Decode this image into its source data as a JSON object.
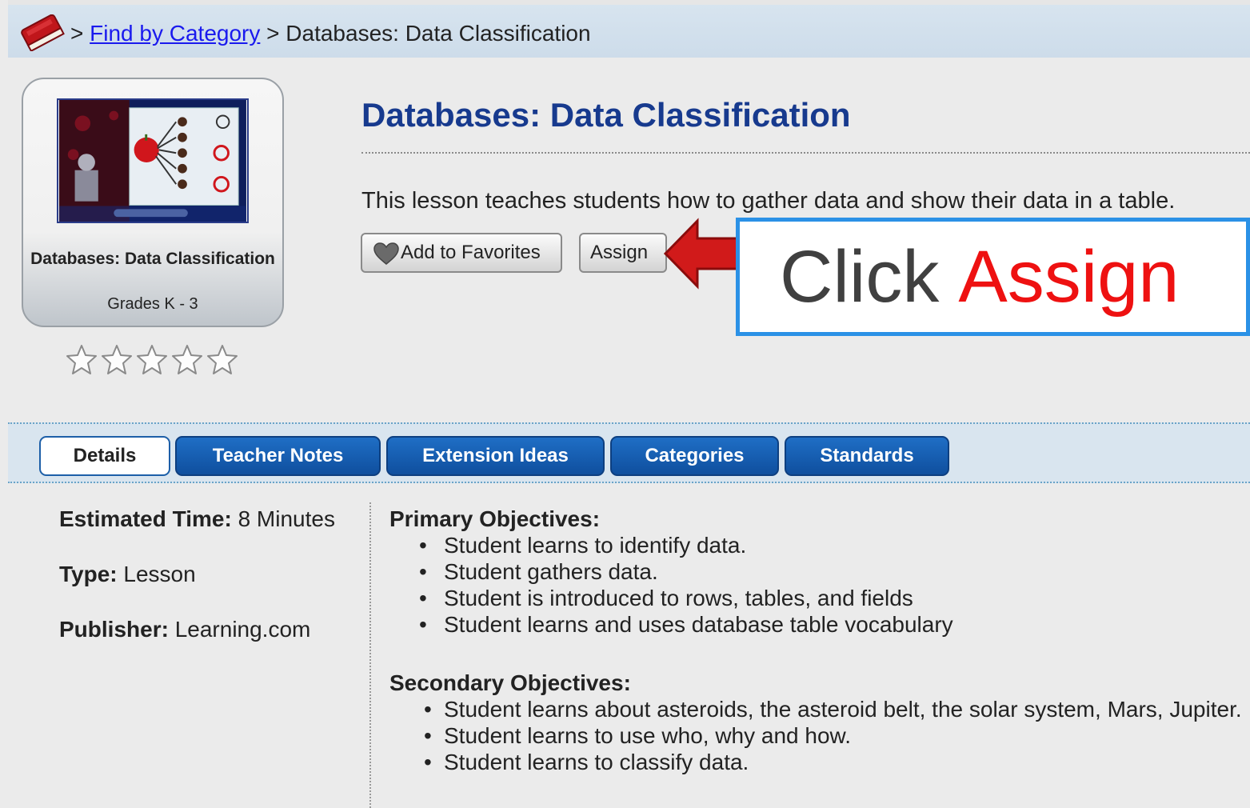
{
  "breadcrumb": {
    "separator": ">",
    "link_label": "Find by Category",
    "current": "Databases: Data Classification"
  },
  "card": {
    "title": "Databases: Data Classification",
    "grades": "Grades K - 3"
  },
  "rating": {
    "filled_stars": 0,
    "max_stars": 5
  },
  "lesson": {
    "title": "Databases: Data Classification",
    "description": "This lesson teaches students how to gather data and show their data in a table."
  },
  "buttons": {
    "favorites_label": "Add to Favorites",
    "assign_label": "Assign"
  },
  "callout": {
    "word1": "Click",
    "word2": "Assign"
  },
  "tabs": [
    {
      "label": "Details",
      "active": true
    },
    {
      "label": "Teacher Notes",
      "active": false
    },
    {
      "label": "Extension Ideas",
      "active": false
    },
    {
      "label": "Categories",
      "active": false
    },
    {
      "label": "Standards",
      "active": false
    }
  ],
  "details": {
    "time_label": "Estimated Time:",
    "time_value": "8 Minutes",
    "type_label": "Type:",
    "type_value": "Lesson",
    "publisher_label": "Publisher:",
    "publisher_value": "Learning.com"
  },
  "objectives": {
    "primary_heading": "Primary Objectives:",
    "primary": [
      "Student learns to identify data.",
      "Student gathers data.",
      "Student is introduced to rows, tables, and fields",
      "Student learns and uses database table vocabulary"
    ],
    "secondary_heading": "Secondary Objectives:",
    "secondary": [
      "Student learns about asteroids, the asteroid belt, the solar system, Mars, Jupiter.",
      "Student learns to use who, why and how.",
      "Student learns to classify data."
    ]
  },
  "colors": {
    "title_blue": "#173a8e",
    "tab_blue": "#1f6ec5",
    "callout_border": "#2b91e6",
    "callout_red": "#ee1111",
    "arrow_red": "#d11a1a"
  },
  "icons": {
    "breadcrumb": "book-icon",
    "favorite": "heart-icon",
    "rating": "star-icon",
    "pointer": "arrow-left-icon"
  }
}
